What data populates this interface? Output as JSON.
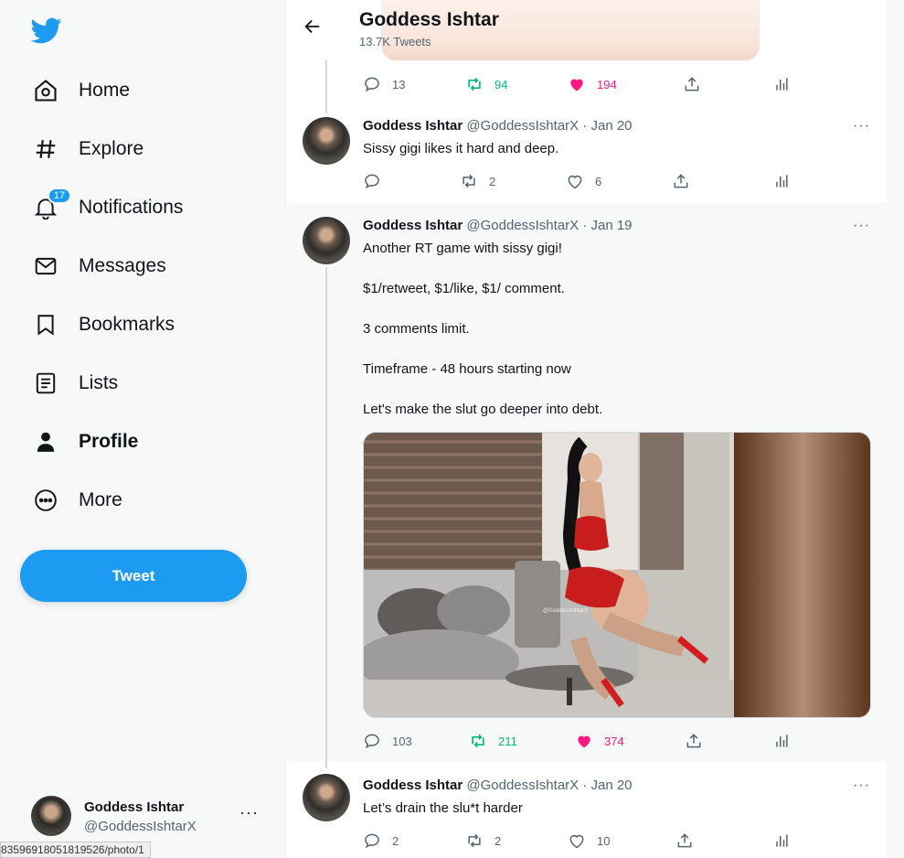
{
  "sidebar": {
    "nav": [
      {
        "label": "Home",
        "icon": "home-icon"
      },
      {
        "label": "Explore",
        "icon": "hashtag-icon"
      },
      {
        "label": "Notifications",
        "icon": "bell-icon",
        "badge": "17"
      },
      {
        "label": "Messages",
        "icon": "mail-icon"
      },
      {
        "label": "Bookmarks",
        "icon": "bookmark-icon"
      },
      {
        "label": "Lists",
        "icon": "list-icon"
      },
      {
        "label": "Profile",
        "icon": "person-icon"
      },
      {
        "label": "More",
        "icon": "more-circle-icon"
      }
    ],
    "tweet_button": "Tweet",
    "account": {
      "name": "Goddess Ishtar",
      "handle": "@GoddessIshtarX",
      "more": "···"
    }
  },
  "status_url": "83596918051819526/photo/1",
  "header": {
    "title": "Goddess Ishtar",
    "subtitle": "13.7K Tweets"
  },
  "top_actions": {
    "reply": "13",
    "retweet": "94",
    "like": "194"
  },
  "tweets": [
    {
      "name": "Goddess Ishtar",
      "meta": "@GoddessIshtarX · Jan 20",
      "text": "Sissy gigi likes it hard and deep.",
      "reply": "",
      "retweet": "2",
      "like": "6"
    },
    {
      "name": "Goddess Ishtar",
      "meta": "@GoddessIshtarX · Jan 19",
      "paragraphs": [
        "Another RT game with sissy gigi!",
        "$1/retweet, $1/like, $1/ comment.",
        "3 comments limit.",
        "Timeframe - 48 hours starting now",
        "Let's make the slut go deeper into debt."
      ],
      "photo_watermark": "@GoddessIshtarX",
      "reply": "103",
      "retweet": "211",
      "like": "374"
    },
    {
      "name": "Goddess Ishtar",
      "meta": "@GoddessIshtarX · Jan 20",
      "text": "Let’s drain the slu*t harder",
      "reply": "2",
      "retweet": "2",
      "like": "10"
    }
  ],
  "more_label": "···",
  "colors": {
    "accent": "#1d9bf0",
    "retweet": "#00ba7c",
    "like": "#f91880"
  }
}
